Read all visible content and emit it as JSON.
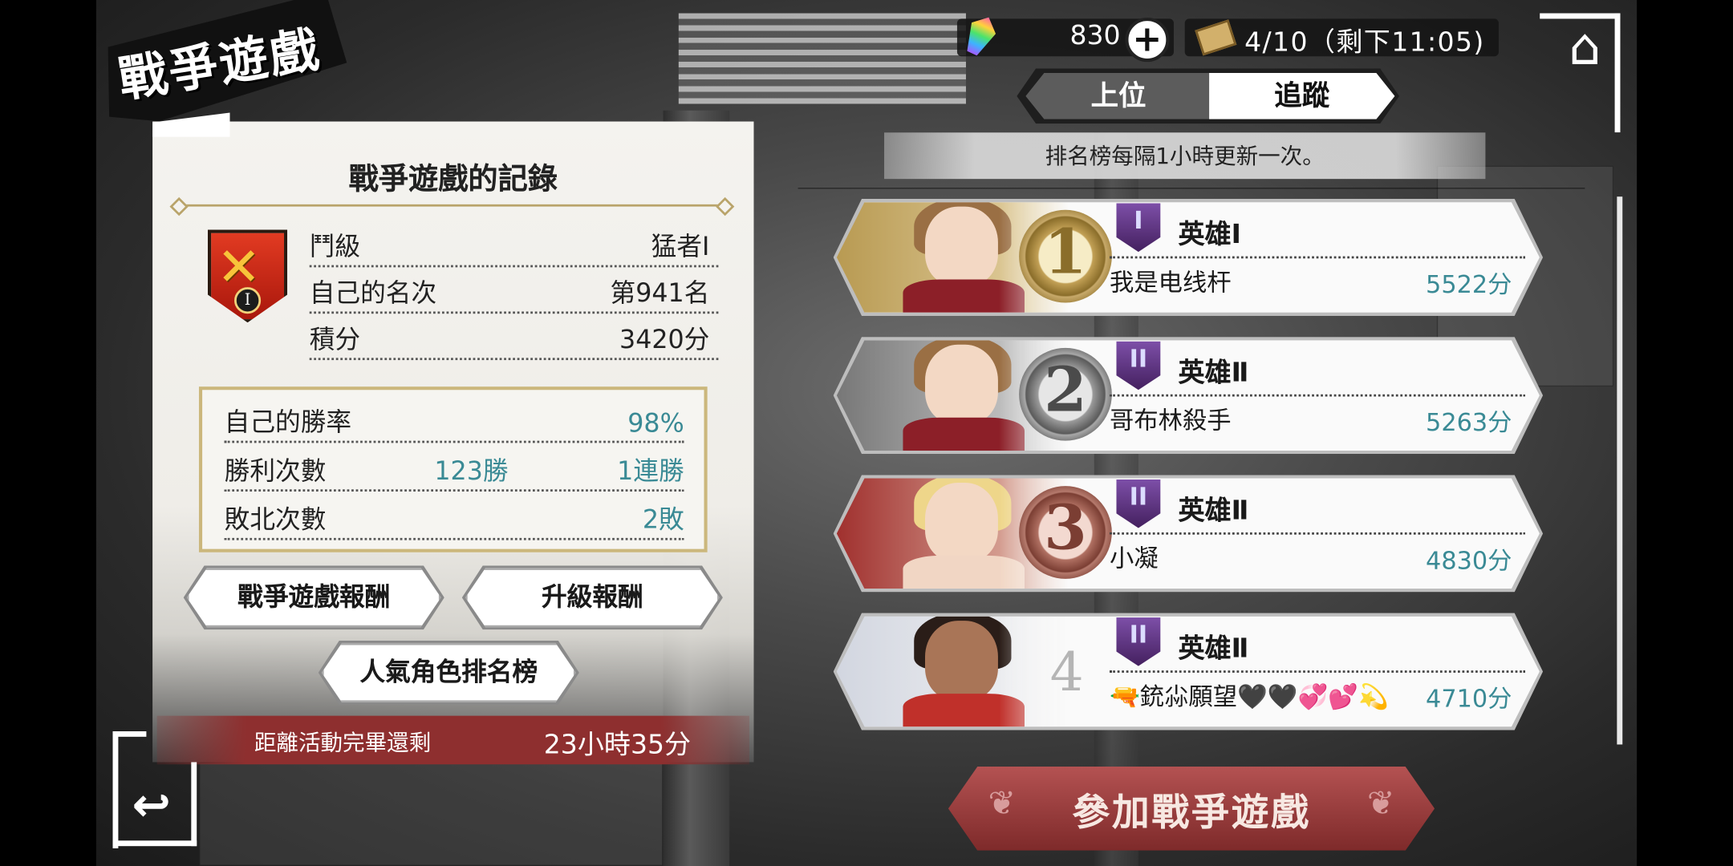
{
  "header": {
    "title": "戰爭遊戲",
    "gems": "830",
    "tickets": "4/10（剩下11:05)",
    "icons": {
      "gem": "rainbow-gem-icon",
      "ticket": "ticket-icon",
      "home": "home-icon",
      "plus": "plus-icon",
      "back": "back-arrow-icon"
    }
  },
  "record": {
    "title": "戰爭遊戲的記錄",
    "tier_badge": "I",
    "rows": [
      {
        "label": "鬥級",
        "value": "猛者Ⅰ"
      },
      {
        "label": "自己的名次",
        "value": "第941名"
      },
      {
        "label": "積分",
        "value": "3420分"
      }
    ],
    "win_rate_label": "自己的勝率",
    "win_rate_value": "98%",
    "wins_label": "勝利次數",
    "wins_value": "123勝",
    "streak_value": "1連勝",
    "losses_label": "敗北次數",
    "losses_value": "2敗"
  },
  "buttons": {
    "war_game_rewards": "戰爭遊戲報酬",
    "promotion_rewards": "升級報酬",
    "popular_ranking": "人氣角色排名榜",
    "join": "參加戰爭遊戲"
  },
  "countdown": {
    "label": "距離活動完畢還剩",
    "value": "23小時35分"
  },
  "tabs": {
    "upper": "上位",
    "track": "追蹤",
    "active": "track"
  },
  "notice": "排名榜每隔1小時更新一次。",
  "ranking": [
    {
      "rank": "1",
      "tier_badge": "I",
      "tier": "英雄Ⅰ",
      "name": "我是电线杆",
      "score": "5522分"
    },
    {
      "rank": "2",
      "tier_badge": "II",
      "tier": "英雄Ⅱ",
      "name": "哥布林殺手",
      "score": "5263分"
    },
    {
      "rank": "3",
      "tier_badge": "II",
      "tier": "英雄Ⅱ",
      "name": "小凝",
      "score": "4830分"
    },
    {
      "rank": "4",
      "tier_badge": "II",
      "tier": "英雄Ⅱ",
      "name": "🔫銃尛願望🖤🖤💞💕💫",
      "score": "4710分"
    }
  ],
  "colors": {
    "accent_teal": "#3a8a95",
    "join_red": "#8e2f2f",
    "gold": "#cbb77c"
  }
}
